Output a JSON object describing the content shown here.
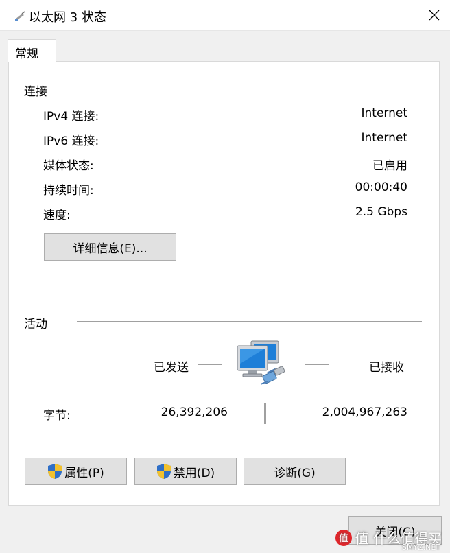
{
  "window": {
    "title": "以太网 3 状态",
    "icon": "network-adapter-icon",
    "close_icon": "close-icon"
  },
  "tabs": [
    {
      "label": "常规"
    }
  ],
  "connection": {
    "heading": "连接",
    "rows": [
      {
        "label": "IPv4 连接:",
        "value": "Internet"
      },
      {
        "label": "IPv6 连接:",
        "value": "Internet"
      },
      {
        "label": "媒体状态:",
        "value": "已启用"
      },
      {
        "label": "持续时间:",
        "value": "00:00:40"
      },
      {
        "label": "速度:",
        "value": "2.5 Gbps"
      }
    ],
    "details_button": "详细信息(E)..."
  },
  "activity": {
    "heading": "活动",
    "sent_label": "已发送",
    "received_label": "已接收",
    "bytes_label": "字节:",
    "bytes_sent": "26,392,206",
    "bytes_received": "2,004,967,263",
    "icon": "network-computers-icon"
  },
  "buttons": {
    "properties": "属性(P)",
    "disable": "禁用(D)",
    "diagnose": "诊断(G)",
    "close": "关闭(C)"
  },
  "watermark": {
    "text": "值 什么值得买",
    "site": "SMYZ.NET"
  },
  "colors": {
    "shield_blue": "#2f6fc7",
    "shield_yellow": "#f2c12e",
    "monitor_blue": "#1e7fd8"
  }
}
